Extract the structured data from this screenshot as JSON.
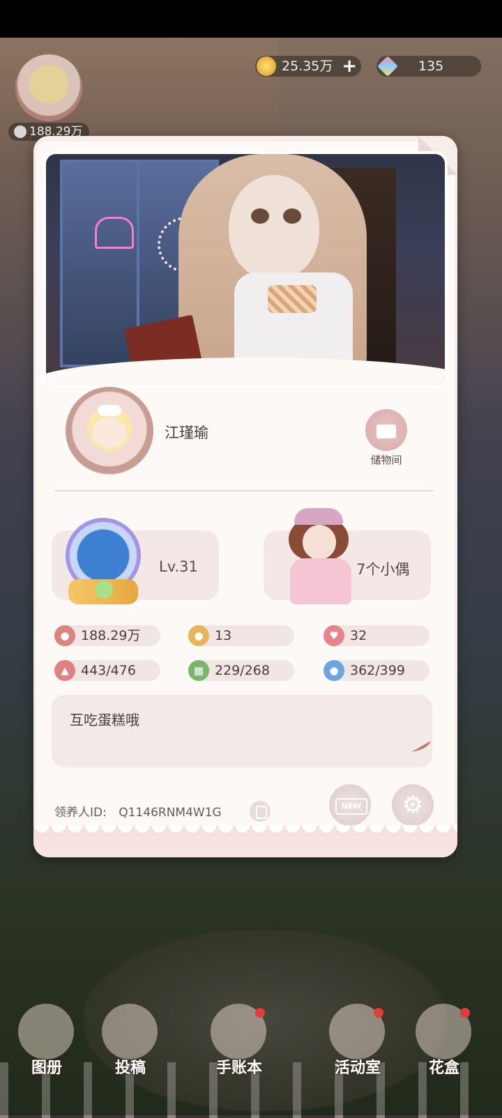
{
  "hud": {
    "followers": "188.29万",
    "coins": "25.35万",
    "coin_plus": "+",
    "gems": "135"
  },
  "profile": {
    "nickname": "江瑾瑜",
    "storage_label": "储物间",
    "level": "Lv.31",
    "dolls": "7个小偶",
    "stats": [
      {
        "icon": "followers-icon",
        "value": "188.29万",
        "color": "#d9847f"
      },
      {
        "icon": "footprint-icon",
        "value": "13",
        "color": "#e9b35a"
      },
      {
        "icon": "heart-chat-icon",
        "value": "32",
        "color": "#e8838e"
      },
      {
        "icon": "dress-icon",
        "value": "443/476",
        "color": "#e08080"
      },
      {
        "icon": "furniture-icon",
        "value": "229/268",
        "color": "#79b56b"
      },
      {
        "icon": "bag-icon",
        "value": "362/399",
        "color": "#6aa6dd"
      }
    ],
    "bio": "互吃蛋糕哦",
    "id_label": "领养人ID:",
    "id_value": "Q1146RNM4W1G",
    "notice_badge": "NEW",
    "notice_label": "公告",
    "settings_label": "设置"
  },
  "nav": [
    {
      "label": "图册",
      "badge": false
    },
    {
      "label": "投稿",
      "badge": false
    },
    {
      "label": "手账本",
      "badge": true
    },
    {
      "label": "活动室",
      "badge": true
    },
    {
      "label": "花盒",
      "badge": true
    }
  ],
  "colors": {
    "card_bg": "#fdf9f7",
    "panel_bg": "#f4e8e6",
    "text": "#4a3c38",
    "accent_pink": "#d8a9a9"
  }
}
